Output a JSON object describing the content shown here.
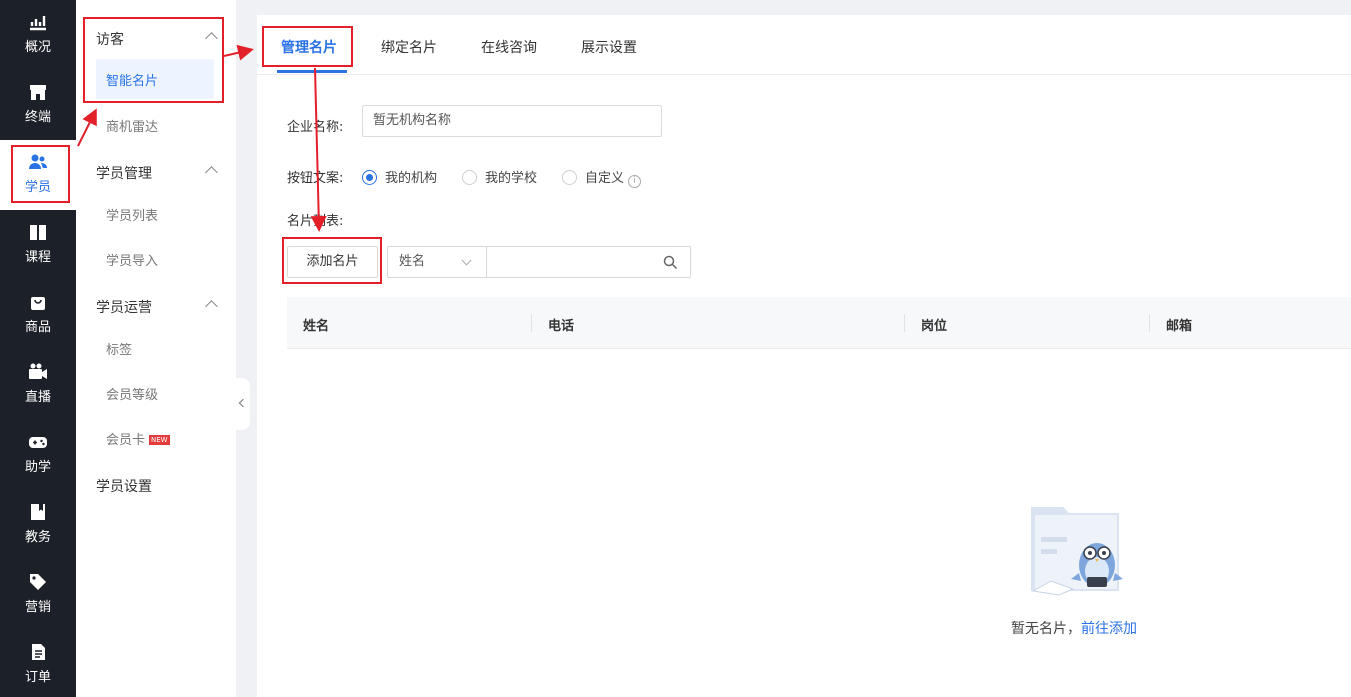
{
  "rail": {
    "items": [
      {
        "label": "概况",
        "icon": "chart-icon"
      },
      {
        "label": "终端",
        "icon": "store-icon"
      },
      {
        "label": "学员",
        "icon": "users-icon",
        "active": true
      },
      {
        "label": "课程",
        "icon": "book-icon"
      },
      {
        "label": "商品",
        "icon": "bag-icon"
      },
      {
        "label": "直播",
        "icon": "camera-icon"
      },
      {
        "label": "助学",
        "icon": "gamepad-icon"
      },
      {
        "label": "教务",
        "icon": "notebook-icon"
      },
      {
        "label": "营销",
        "icon": "tag-icon"
      },
      {
        "label": "订单",
        "icon": "document-icon"
      }
    ]
  },
  "subnav": {
    "visitor": {
      "title": "访客",
      "items": [
        "智能名片",
        "商机雷达"
      ]
    },
    "student_mgmt": {
      "title": "学员管理",
      "items": [
        "学员列表",
        "学员导入"
      ]
    },
    "student_ops": {
      "title": "学员运营",
      "items": [
        "标签",
        "会员等级",
        "会员卡"
      ],
      "new_badge": "NEW"
    },
    "student_settings": {
      "title": "学员设置"
    }
  },
  "tabs": [
    "管理名片",
    "绑定名片",
    "在线咨询",
    "展示设置"
  ],
  "form": {
    "company_label": "企业名称:",
    "company_placeholder": "暂无机构名称",
    "button_copy_label": "按钮文案:",
    "radio_options": [
      "我的机构",
      "我的学校",
      "自定义"
    ],
    "selected_option": "我的机构",
    "list_label": "名片列表:",
    "add_button": "添加名片",
    "filter_select": "姓名"
  },
  "table": {
    "columns": [
      "姓名",
      "电话",
      "岗位",
      "邮箱"
    ]
  },
  "empty": {
    "text": "暂无名片，",
    "link": "前往添加"
  },
  "colors": {
    "accent": "#2a72e5",
    "rail_bg": "#1c2028",
    "annotation": "#e3202a"
  }
}
